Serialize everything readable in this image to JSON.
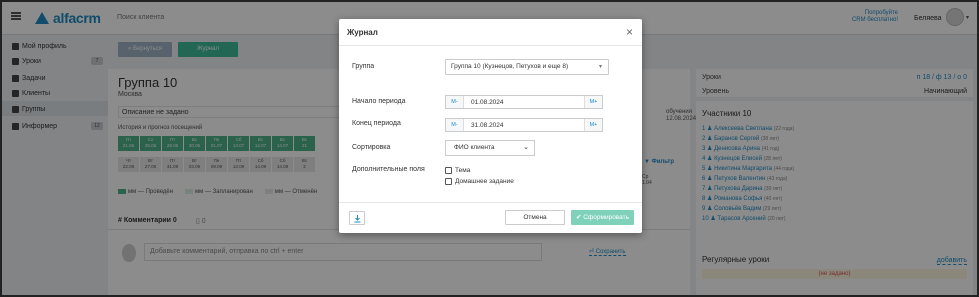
{
  "topbar": {
    "logo_text": "alfacrm",
    "search_label": "Поиск клиента",
    "promo_line1": "Попробуйте",
    "promo_line2": "CRM бесплатно!",
    "user_name": "Беляева"
  },
  "sidebar": {
    "items": [
      {
        "label": "Мой профиль",
        "badge": ""
      },
      {
        "label": "Уроки",
        "badge": "7"
      },
      {
        "label": "Задачи",
        "badge": ""
      },
      {
        "label": "Клиенты",
        "badge": ""
      },
      {
        "label": "Группы",
        "badge": ""
      },
      {
        "label": "Информер",
        "badge": "12"
      }
    ]
  },
  "main": {
    "back_button": "« Вернуться",
    "journal_button": "Журнал",
    "group_title": "Группа 10",
    "city": "Москва",
    "description": "Описание не задано",
    "history_label": "История и прогноз посещений",
    "lessons_row1": [
      {
        "day": "Пт",
        "date": "21.06"
      },
      {
        "day": "Со",
        "date": "26.06"
      },
      {
        "day": "Пт",
        "date": "28.06"
      },
      {
        "day": "Вс",
        "date": "30.06"
      },
      {
        "day": "Пн",
        "date": "01.07"
      },
      {
        "day": "Сб",
        "date": "13.07"
      },
      {
        "day": "Вс",
        "date": "14.07"
      },
      {
        "day": "Вс",
        "date": "14.07"
      },
      {
        "day": "Вс",
        "date": "21"
      }
    ],
    "lessons_row2": [
      {
        "day": "Чт",
        "date": "22.08"
      },
      {
        "day": "Вт",
        "date": "27.08"
      },
      {
        "day": "Пт",
        "date": "31.08"
      },
      {
        "day": "Вт",
        "date": "03.09"
      },
      {
        "day": "Пн",
        "date": "09.09"
      },
      {
        "day": "Пт",
        "date": "13.09"
      },
      {
        "day": "Сб",
        "date": "14.09"
      },
      {
        "day": "Сб",
        "date": "14.09"
      },
      {
        "day": "Вс",
        "date": "2"
      }
    ],
    "legend": {
      "done": "мм — Проведён",
      "planned": "мм — Запланирован",
      "cancelled": "мм — Отменён"
    },
    "right_fragment_line1": "обучения",
    "right_fragment_line2": "12.08.2024",
    "filter": "Фильтр",
    "frag_lesson_day": "Ср",
    "frag_lesson_date": "1.04",
    "tab_comments": "Комментарии 0",
    "tab_files": "0",
    "comment_placeholder": "Добавьте комментарий, отправка по ctrl + enter",
    "save_link": "Сохранить"
  },
  "right": {
    "lessons_label": "Уроки",
    "lessons_value": "п 18 / ф 13 / о 0",
    "level_label": "Уровень",
    "level_value": "Начинающий",
    "participants_title": "Участники",
    "participants_count": "10",
    "participants": [
      {
        "n": "1",
        "name": "Алексеева Светлана",
        "age": "(22 года)"
      },
      {
        "n": "2",
        "name": "Баранов Сергей",
        "age": "(38 лет)"
      },
      {
        "n": "3",
        "name": "Денисова Арина",
        "age": "(41 год)"
      },
      {
        "n": "4",
        "name": "Кузнецов Елисей",
        "age": "(28 лет)"
      },
      {
        "n": "5",
        "name": "Никитина Маргарита",
        "age": "(44 года)"
      },
      {
        "n": "6",
        "name": "Петухов Валентин",
        "age": "(43 года)"
      },
      {
        "n": "7",
        "name": "Петухова Дарина",
        "age": "(30 лет)"
      },
      {
        "n": "8",
        "name": "Романова Софья",
        "age": "(40 лет)"
      },
      {
        "n": "9",
        "name": "Соловьёв Вадим",
        "age": "(29 лет)"
      },
      {
        "n": "10",
        "name": "Тарасов Арсений",
        "age": "(20 лет)"
      }
    ],
    "regular_title": "Регулярные уроки",
    "regular_add": "добавить",
    "regular_empty": "(не задано)"
  },
  "modal": {
    "title": "Журнал",
    "close": "×",
    "group_label": "Группа",
    "group_value": "Группа 10 (Кузнецов, Петухов и еще 8)",
    "start_label": "Начало периода",
    "start_value": "01.08.2024",
    "end_label": "Конец периода",
    "end_value": "31.08.2024",
    "minus": "М-",
    "plus": "М+",
    "sort_label": "Сортировка",
    "sort_value": "ФИО клиента",
    "extra_label": "Дополнительные поля",
    "extra_topic": "Тема",
    "extra_homework": "Домашнее задание",
    "cancel": "Отмена",
    "submit": "✔ Сформировать"
  },
  "colors": {
    "accent": "#1e8bc3",
    "green": "#3fbc9a",
    "submit_disabled": "#7fd1ba"
  }
}
